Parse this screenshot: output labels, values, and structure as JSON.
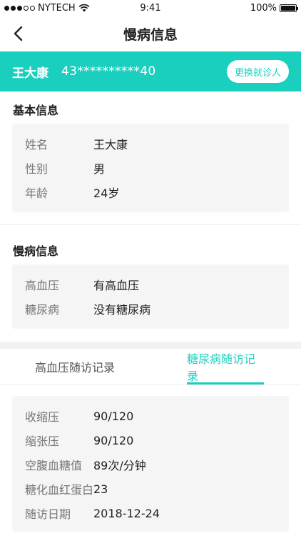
{
  "status_bar": {
    "carrier": "NYTECH",
    "time": "9:41",
    "battery_text": "100%",
    "battery_level": 1.0,
    "signal_bars_filled": 3,
    "signal_bars_total": 5
  },
  "nav": {
    "title": "慢病信息",
    "back_icon": "chevron-left-icon"
  },
  "patient": {
    "name": "王大康",
    "id_masked": "43**********40",
    "switch_label": "更换就诊人"
  },
  "basic_info": {
    "title": "基本信息",
    "rows": [
      {
        "label": "姓名",
        "value": "王大康"
      },
      {
        "label": "性别",
        "value": "男"
      },
      {
        "label": "年龄",
        "value": "24岁"
      }
    ]
  },
  "chronic_info": {
    "title": "慢病信息",
    "rows": [
      {
        "label": "高血压",
        "value": "有高血压"
      },
      {
        "label": "糖尿病",
        "value": "没有糖尿病"
      }
    ]
  },
  "tabs": [
    {
      "label": "高血压随访记录",
      "active": false
    },
    {
      "label": "糖尿病随访记录",
      "active": true
    }
  ],
  "followup": {
    "rows": [
      {
        "label": "收缩压",
        "value": "90/120"
      },
      {
        "label": "缩张压",
        "value": "90/120"
      },
      {
        "label": "空腹血糖值",
        "value": "89次/分钟"
      },
      {
        "label": "糖化血红蛋白",
        "value": "23"
      },
      {
        "label": "随访日期",
        "value": "2018-12-24"
      }
    ]
  },
  "colors": {
    "accent": "#1bcfbf",
    "card_bg": "#f5f5f5",
    "label": "#777777",
    "value": "#222222"
  }
}
